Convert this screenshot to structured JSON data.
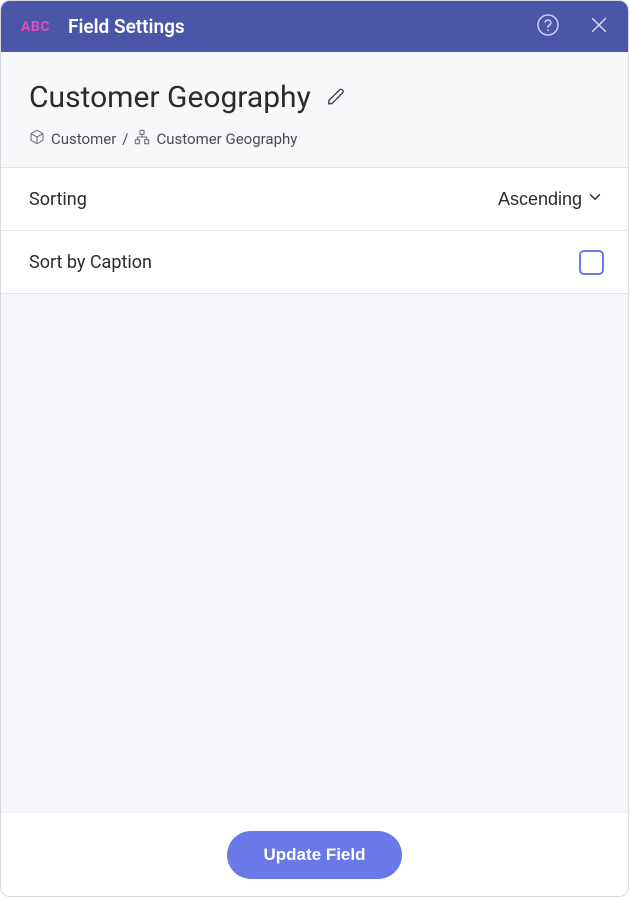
{
  "header": {
    "badge": "ABC",
    "title": "Field Settings"
  },
  "field": {
    "name": "Customer Geography"
  },
  "breadcrumb": {
    "root": "Customer",
    "current": "Customer Geography"
  },
  "settings": {
    "sorting_label": "Sorting",
    "sorting_value": "Ascending",
    "sort_by_caption_label": "Sort by Caption",
    "sort_by_caption_checked": false
  },
  "footer": {
    "update_label": "Update Field"
  }
}
